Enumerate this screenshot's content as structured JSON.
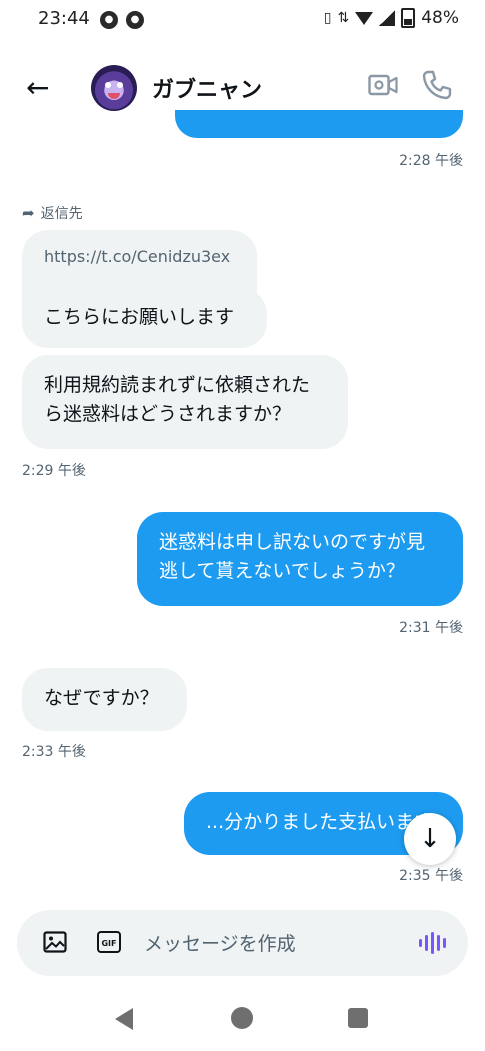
{
  "status_bar": {
    "time": "23:44",
    "battery_pct": "48%",
    "app_icon_1": "●",
    "app_icon_2": "●"
  },
  "header": {
    "contact_name": "ガブニャン",
    "back_icon": "←",
    "video_icon": "video-camera-icon",
    "call_icon": "phone-icon"
  },
  "conversation": {
    "reply_label": "返信先",
    "link_preview": "https://t.co/Cenidzu3ex",
    "messages": [
      {
        "direction": "incoming",
        "text": "こちらにお願いします"
      },
      {
        "direction": "incoming",
        "text": "利用規約読まれずに依頼されたら迷惑料はどうされますか？",
        "time": "2:29 午後"
      },
      {
        "direction": "outgoing",
        "text": "迷惑料は申し訳ないのですが見逃して貰えないでしょうか？",
        "time": "2:31 午後"
      },
      {
        "direction": "incoming",
        "text": "なぜですか？",
        "time": "2:33 午後"
      },
      {
        "direction": "outgoing",
        "text": "...分かりました支払います",
        "time": "2:35 午後"
      }
    ],
    "earlier_time": "2:28 午後"
  },
  "composer": {
    "placeholder": "メッセージを作成",
    "gif_label": "GIF"
  },
  "colors": {
    "accent": "#1d9bf0",
    "incoming_bg": "#eff3f4",
    "voice": "#7856ff"
  }
}
